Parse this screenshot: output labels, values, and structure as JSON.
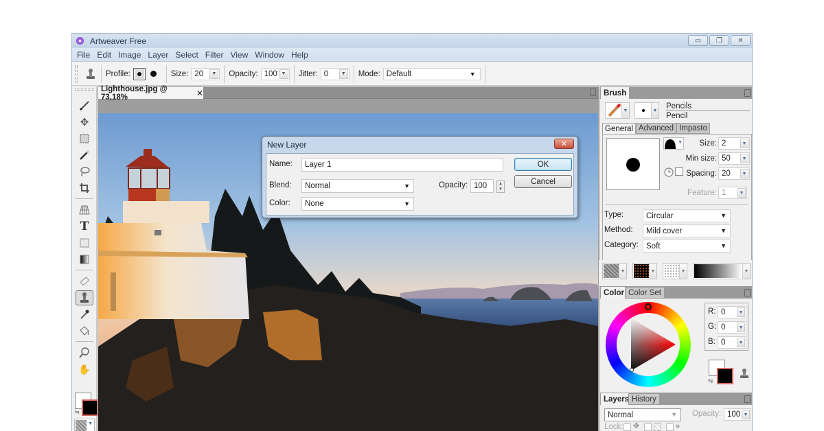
{
  "window": {
    "title": "Artweaver Free",
    "buttons": {
      "minimize": "▭",
      "restore": "❐",
      "close": "✕"
    }
  },
  "menu": [
    "File",
    "Edit",
    "Image",
    "Layer",
    "Select",
    "Filter",
    "View",
    "Window",
    "Help"
  ],
  "toolbar": {
    "tool_icon": "stamp-icon",
    "profile_label": "Profile:",
    "size_label": "Size:",
    "size_value": "20",
    "opacity_label": "Opacity:",
    "opacity_value": "100",
    "jitter_label": "Jitter:",
    "jitter_value": "0",
    "mode_label": "Mode:",
    "mode_value": "Default"
  },
  "tools": [
    {
      "name": "brush",
      "glyph": "✎"
    },
    {
      "name": "move",
      "glyph": "✥"
    },
    {
      "name": "rect-select",
      "glyph": "⬚"
    },
    {
      "name": "magic-wand",
      "glyph": "⚚"
    },
    {
      "name": "lasso",
      "glyph": "❍"
    },
    {
      "name": "crop",
      "glyph": "⌗"
    },
    {
      "name": "perspective",
      "glyph": "⊞"
    },
    {
      "name": "text",
      "glyph": "T"
    },
    {
      "name": "shape",
      "glyph": "▢"
    },
    {
      "name": "gradient",
      "glyph": "◧"
    },
    {
      "name": "eraser",
      "glyph": "⌫"
    },
    {
      "name": "clone-stamp",
      "glyph": "⚲"
    },
    {
      "name": "eyedropper",
      "glyph": "⟋"
    },
    {
      "name": "paint-bucket",
      "glyph": "⛾"
    },
    {
      "name": "zoom",
      "glyph": "⚲"
    },
    {
      "name": "hand",
      "glyph": "✋"
    }
  ],
  "document": {
    "tab_label": "Lighthouse.jpg @ 73,18%",
    "close_glyph": "✕"
  },
  "dialog": {
    "title": "New Layer",
    "close_glyph": "✕",
    "name_label": "Name:",
    "name_value": "Layer 1",
    "blend_label": "Blend:",
    "blend_value": "Normal",
    "opacity_label": "Opacity:",
    "opacity_value": "100",
    "color_label": "Color:",
    "color_value": "None",
    "ok_label": "OK",
    "cancel_label": "Cancel"
  },
  "brush_panel": {
    "tab": "Brush",
    "category": "Pencils",
    "variant": "Pencil",
    "subtabs": [
      "General",
      "Advanced",
      "Impasto"
    ],
    "size_label": "Size:",
    "size_value": "2",
    "min_size_label": "Min size:",
    "min_size_value": "50",
    "spacing_label": "Spacing:",
    "spacing_value": "20",
    "feature_label": "Feature:",
    "feature_value": "1",
    "type_label": "Type:",
    "type_value": "Circular",
    "method_label": "Method:",
    "method_value": "Mild cover",
    "category_label": "Category:",
    "category_value": "Soft"
  },
  "color_panel": {
    "tabs": [
      "Color",
      "Color Set"
    ],
    "r_label": "R:",
    "r_value": "0",
    "g_label": "G:",
    "g_value": "0",
    "b_label": "B:",
    "b_value": "0",
    "foreground": "#000000",
    "background": "#ffffff"
  },
  "layers_panel": {
    "tabs": [
      "Layers",
      "History"
    ],
    "blend_value": "Normal",
    "opacity_label": "Opacity:",
    "opacity_value": "100",
    "lock_label": "Lock:"
  }
}
